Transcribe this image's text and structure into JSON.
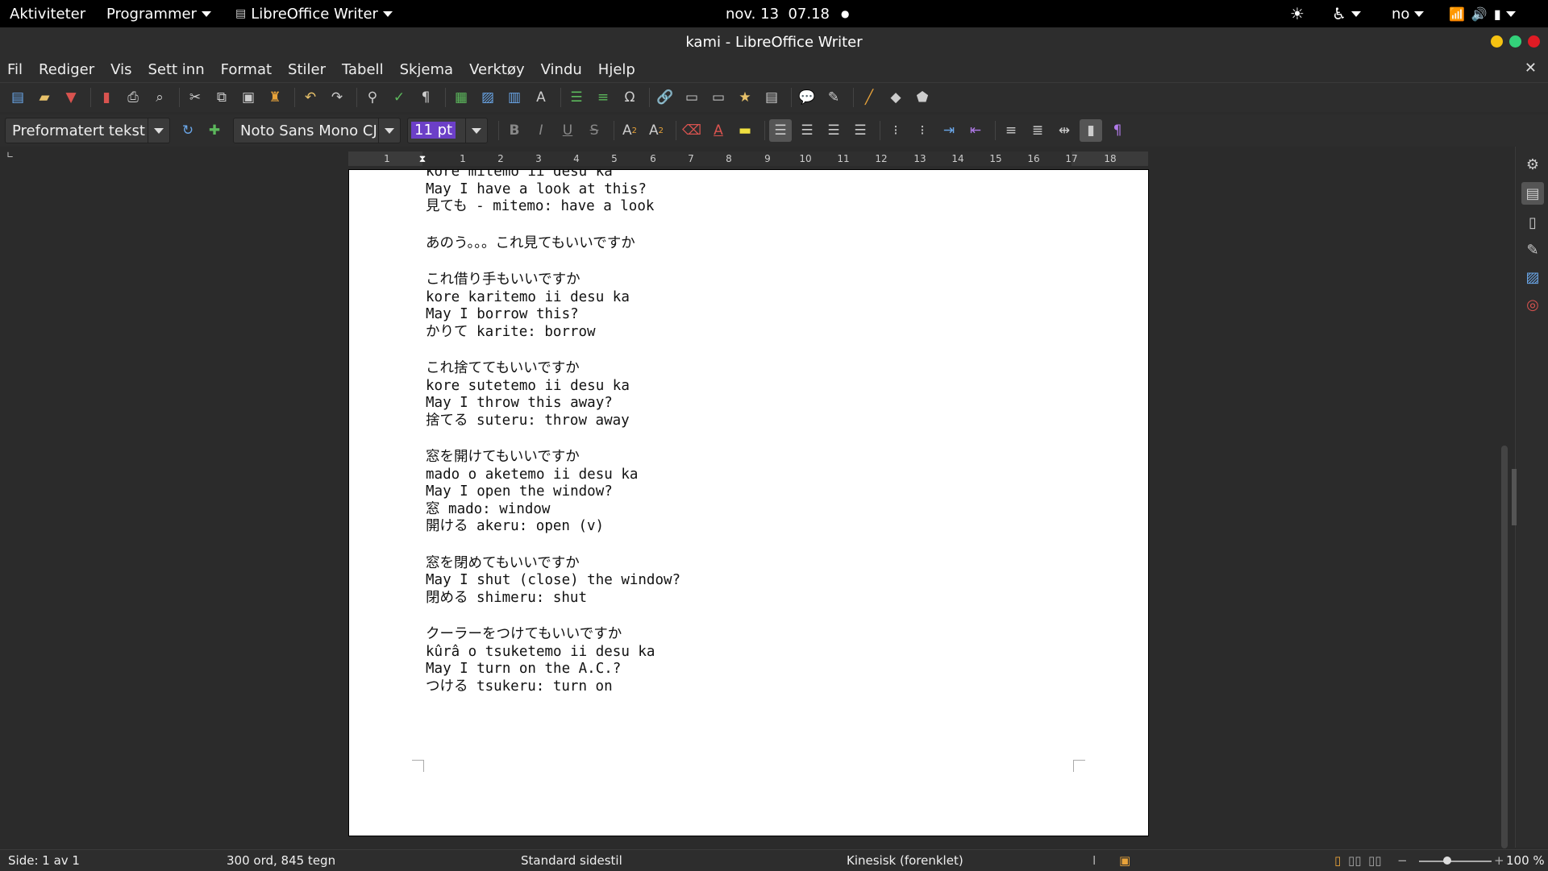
{
  "topbar": {
    "activities": "Aktiviteter",
    "programs": "Programmer",
    "app": "LibreOffice Writer",
    "datetime": "nov. 13  07.18",
    "language": "no"
  },
  "window": {
    "title": "kami - LibreOffice Writer",
    "colors": {
      "minimize": "#f5c211",
      "maximize": "#33d17a",
      "close": "#e01b24"
    }
  },
  "menu": [
    "Fil",
    "Rediger",
    "Vis",
    "Sett inn",
    "Format",
    "Stiler",
    "Tabell",
    "Skjema",
    "Verktøy",
    "Vindu",
    "Hjelp"
  ],
  "formatting": {
    "paragraph_style": "Preformatert tekst",
    "font_name": "Noto Sans Mono CJ",
    "font_size": "11 pt"
  },
  "ruler": {
    "ticks": [
      "1",
      "1",
      "2",
      "3",
      "4",
      "5",
      "6",
      "7",
      "8",
      "9",
      "10",
      "11",
      "12",
      "13",
      "14",
      "15",
      "16",
      "17",
      "18"
    ]
  },
  "document": {
    "paragraphs": [
      [
        "kore mitemo ii desu ka",
        "May I have a look at this?",
        "見ても - mitemo: have a look"
      ],
      [
        "あのう。。。これ見てもいいですか"
      ],
      [
        "これ借り手もいいですか",
        "kore karitemo ii desu ka",
        "May I borrow this?",
        "かりて karite: borrow"
      ],
      [
        "これ捨ててもいいですか",
        "kore sutetemo ii desu ka",
        "May I throw this away?",
        "捨てる suteru: throw away"
      ],
      [
        "窓を開けてもいいですか",
        "mado o aketemo ii desu ka",
        "May I open the window?",
        "窓 mado: window",
        "開ける akeru: open (v)"
      ],
      [
        "窓を閉めてもいいですか",
        "May I shut (close) the window?",
        "閉める shimeru: shut"
      ],
      [
        "クーラーをつけてもいいですか",
        "kûrâ o tsuketemo ii desu ka",
        "May I turn on the A.C.?",
        "つける tsukeru: turn on"
      ]
    ]
  },
  "status": {
    "page": "Side: 1 av 1",
    "words": "300 ord, 845 tegn",
    "page_style": "Standard sidestil",
    "language": "Kinesisk (forenklet)",
    "zoom": "100 %"
  }
}
